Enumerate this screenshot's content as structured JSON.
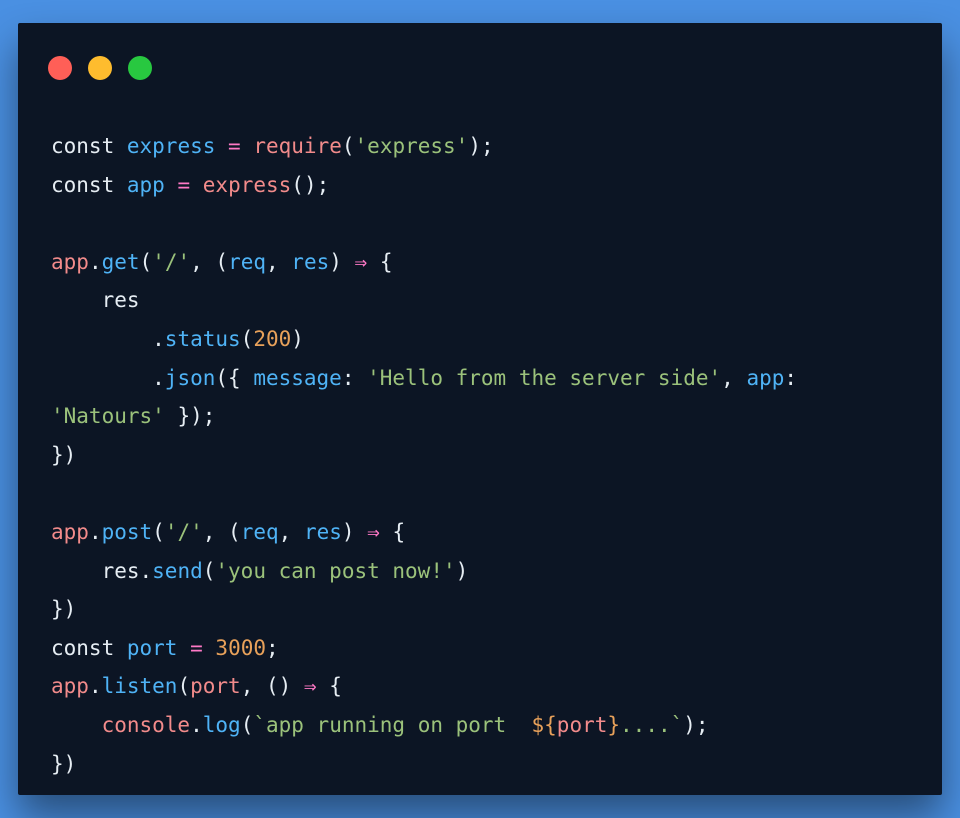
{
  "window": {
    "traffic_lights": [
      {
        "name": "close",
        "color": "#ff5f57"
      },
      {
        "name": "minimize",
        "color": "#febc2e"
      },
      {
        "name": "maximize",
        "color": "#28c840"
      }
    ]
  },
  "code": {
    "lines": [
      [
        [
          "kw",
          "const"
        ],
        [
          "plain",
          " "
        ],
        [
          "var",
          "express"
        ],
        [
          "plain",
          " "
        ],
        [
          "op",
          "="
        ],
        [
          "plain",
          " "
        ],
        [
          "fn",
          "require"
        ],
        [
          "plain",
          "("
        ],
        [
          "str",
          "'express'"
        ],
        [
          "plain",
          ");"
        ]
      ],
      [
        [
          "kw",
          "const"
        ],
        [
          "plain",
          " "
        ],
        [
          "var",
          "app"
        ],
        [
          "plain",
          " "
        ],
        [
          "op",
          "="
        ],
        [
          "plain",
          " "
        ],
        [
          "fn",
          "express"
        ],
        [
          "plain",
          "();"
        ]
      ],
      [],
      [
        [
          "fn",
          "app"
        ],
        [
          "plain",
          "."
        ],
        [
          "id",
          "get"
        ],
        [
          "plain",
          "("
        ],
        [
          "str",
          "'/'"
        ],
        [
          "plain",
          ", ("
        ],
        [
          "id",
          "req"
        ],
        [
          "plain",
          ", "
        ],
        [
          "id",
          "res"
        ],
        [
          "plain",
          ") "
        ],
        [
          "op",
          "⇒"
        ],
        [
          "plain",
          " {"
        ]
      ],
      [
        [
          "plain",
          "    res"
        ]
      ],
      [
        [
          "plain",
          "        ."
        ],
        [
          "id",
          "status"
        ],
        [
          "plain",
          "("
        ],
        [
          "num",
          "200"
        ],
        [
          "plain",
          ")"
        ]
      ],
      [
        [
          "plain",
          "        ."
        ],
        [
          "id",
          "json"
        ],
        [
          "plain",
          "({ "
        ],
        [
          "id",
          "message"
        ],
        [
          "plain",
          ": "
        ],
        [
          "str",
          "'Hello from the server side'"
        ],
        [
          "plain",
          ", "
        ],
        [
          "id",
          "app"
        ],
        [
          "plain",
          ":"
        ]
      ],
      [
        [
          "str",
          "'Natours'"
        ],
        [
          "plain",
          " });"
        ]
      ],
      [
        [
          "plain",
          "})"
        ]
      ],
      [],
      [
        [
          "fn",
          "app"
        ],
        [
          "plain",
          "."
        ],
        [
          "id",
          "post"
        ],
        [
          "plain",
          "("
        ],
        [
          "str",
          "'/'"
        ],
        [
          "plain",
          ", ("
        ],
        [
          "id",
          "req"
        ],
        [
          "plain",
          ", "
        ],
        [
          "id",
          "res"
        ],
        [
          "plain",
          ") "
        ],
        [
          "op",
          "⇒"
        ],
        [
          "plain",
          " {"
        ]
      ],
      [
        [
          "plain",
          "    res."
        ],
        [
          "id",
          "send"
        ],
        [
          "plain",
          "("
        ],
        [
          "str",
          "'you can post now!'"
        ],
        [
          "plain",
          ")"
        ]
      ],
      [
        [
          "plain",
          "})"
        ]
      ],
      [
        [
          "kw",
          "const"
        ],
        [
          "plain",
          " "
        ],
        [
          "var",
          "port"
        ],
        [
          "plain",
          " "
        ],
        [
          "op",
          "="
        ],
        [
          "plain",
          " "
        ],
        [
          "num",
          "3000"
        ],
        [
          "plain",
          ";"
        ]
      ],
      [
        [
          "fn",
          "app"
        ],
        [
          "plain",
          "."
        ],
        [
          "id",
          "listen"
        ],
        [
          "plain",
          "("
        ],
        [
          "fn",
          "port"
        ],
        [
          "plain",
          ", () "
        ],
        [
          "op",
          "⇒"
        ],
        [
          "plain",
          " {"
        ]
      ],
      [
        [
          "plain",
          "    "
        ],
        [
          "fn",
          "console"
        ],
        [
          "plain",
          "."
        ],
        [
          "id",
          "log"
        ],
        [
          "plain",
          "("
        ],
        [
          "str",
          "`app running on port  "
        ],
        [
          "num",
          "${"
        ],
        [
          "fn",
          "port"
        ],
        [
          "num",
          "}"
        ],
        [
          "str",
          "....`"
        ],
        [
          "plain",
          ");"
        ]
      ],
      [
        [
          "plain",
          "})"
        ]
      ]
    ]
  }
}
